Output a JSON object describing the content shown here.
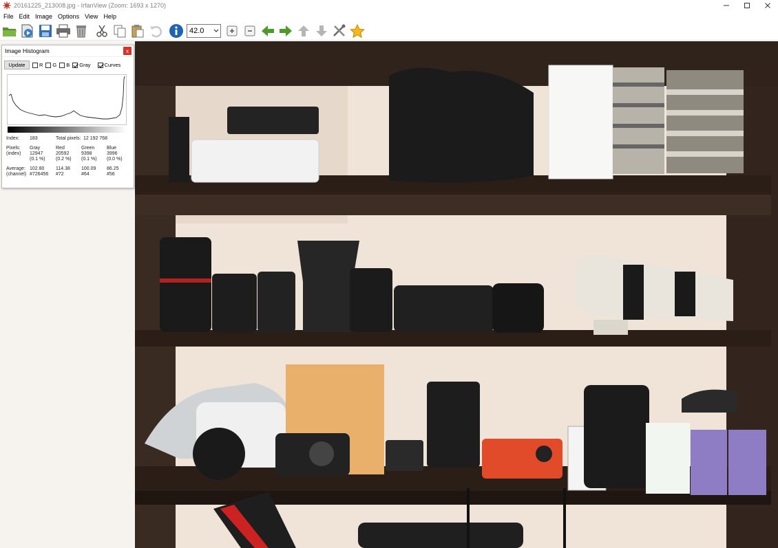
{
  "window": {
    "title": "20161225_213008.jpg - IrfanView (Zoom: 1693 x 1270)"
  },
  "menu": [
    "File",
    "Edit",
    "Image",
    "Options",
    "View",
    "Help"
  ],
  "toolbar": {
    "zoom_value": "42.0",
    "buttons": [
      "open-icon",
      "slideshow-icon",
      "save-icon",
      "print-icon",
      "delete-icon",
      "cut-icon",
      "copy-icon",
      "paste-icon",
      "undo-icon",
      "info-icon",
      "zoom-in-icon",
      "zoom-out-icon",
      "previous-icon",
      "next-icon",
      "first-icon",
      "last-icon",
      "tools-icon",
      "favorites-icon"
    ]
  },
  "histogram": {
    "title": "Image Histogram",
    "close_label": "x",
    "update_label": "Update",
    "checkboxes": [
      {
        "label": "R",
        "checked": false
      },
      {
        "label": "G",
        "checked": false
      },
      {
        "label": "B",
        "checked": false
      },
      {
        "label": "Gray",
        "checked": true
      },
      {
        "label": "Curves",
        "checked": true
      }
    ],
    "index_label": "Index:",
    "index_value": "183",
    "total_label": "Total pixels:",
    "total_value": "12 192 768",
    "pixels_label": "Pixels:",
    "pixels_sub_label": "(index)",
    "average_label": "Average:",
    "average_sub_label": "(channel)",
    "channels": [
      {
        "name": "Gray",
        "pixels": "12947",
        "pixels_pct": "(0.1 %)",
        "average": "102.80",
        "hex": "#726456"
      },
      {
        "name": "Red",
        "pixels": "20592",
        "pixels_pct": "(0.2 %)",
        "average": "114.38",
        "hex": "#72"
      },
      {
        "name": "Green",
        "pixels": "9398",
        "pixels_pct": "(0.1 %)",
        "average": "100.09",
        "hex": "#64"
      },
      {
        "name": "Blue",
        "pixels": "3996",
        "pixels_pct": "(0.0 %)",
        "average": "86.25",
        "hex": "#56"
      }
    ]
  },
  "colors": {
    "shelf_dark": "#2a1e17",
    "wall": "#efe6dc",
    "close_red": "#d8332a",
    "arrow_green": "#4c9a2a"
  }
}
